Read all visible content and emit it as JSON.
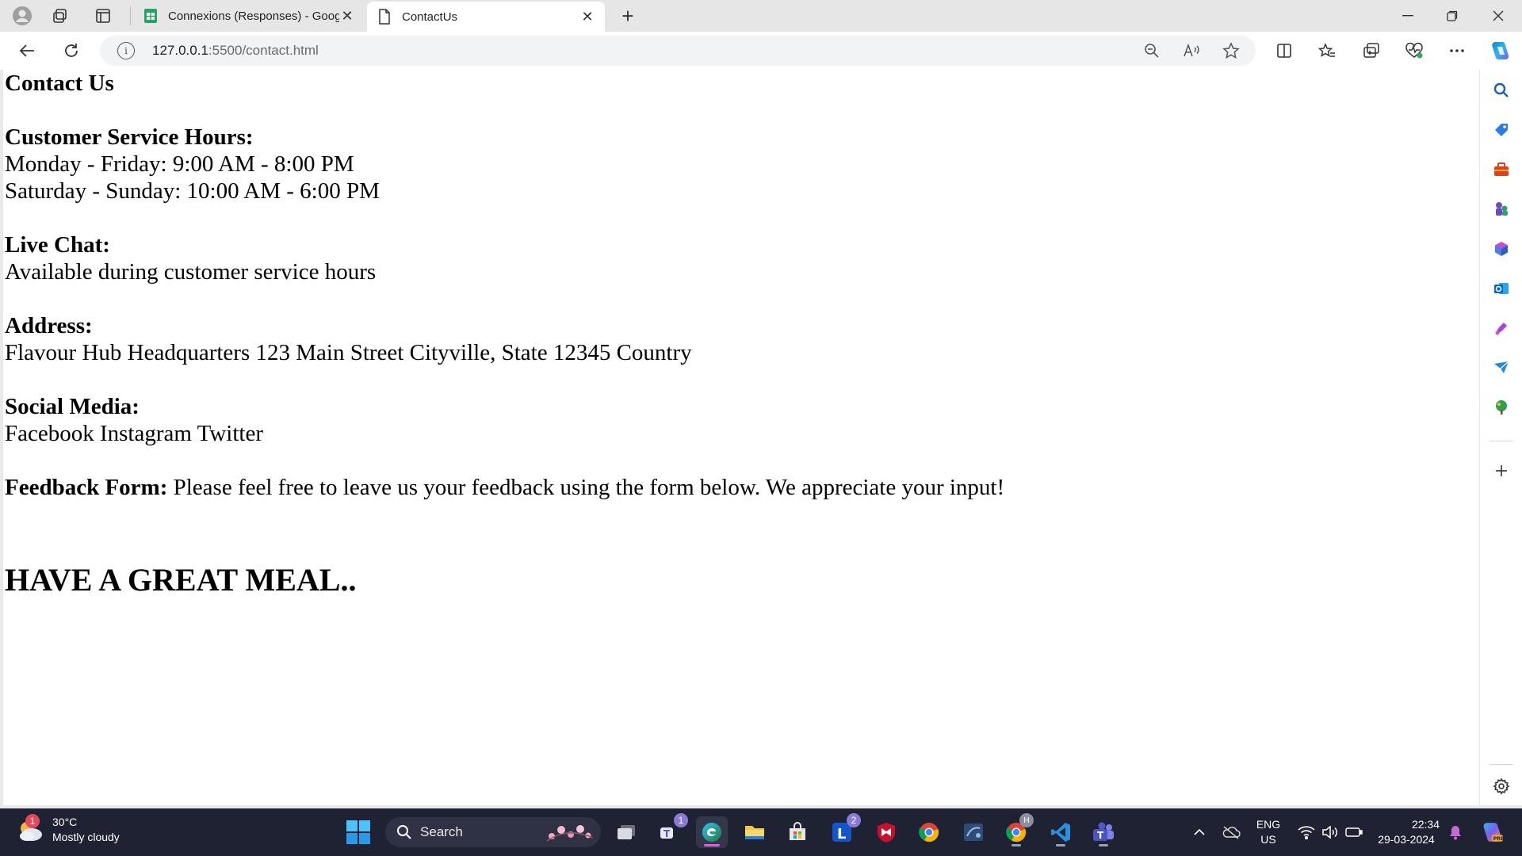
{
  "browser": {
    "tabs": [
      {
        "title": "Connexions (Responses) - Google",
        "active": false
      },
      {
        "title": "ContactUs",
        "active": true
      }
    ],
    "new_tab_label": "+",
    "address": {
      "host": "127.0.0.1",
      "path": ":5500/contact.html"
    }
  },
  "page": {
    "heading": "Contact Us",
    "hours": {
      "label": "Customer Service Hours:",
      "lines": [
        "Monday - Friday: 9:00 AM - 8:00 PM",
        "Saturday - Sunday: 10:00 AM - 6:00 PM"
      ]
    },
    "live_chat": {
      "label": "Live Chat:",
      "text": "Available during customer service hours"
    },
    "address": {
      "label": "Address:",
      "text": "Flavour Hub Headquarters 123 Main Street Cityville, State 12345 Country"
    },
    "social": {
      "label": "Social Media:",
      "text": "Facebook Instagram Twitter"
    },
    "feedback": {
      "label": "Feedback Form:",
      "text": " Please feel free to leave us your feedback using the form below. We appreciate your input!"
    },
    "closing": "HAVE A GREAT MEAL.."
  },
  "taskbar": {
    "weather": {
      "temp": "30°C",
      "condition": "Mostly cloudy",
      "badge": "1"
    },
    "search_label": "Search",
    "teams_badge": "1",
    "l_badge": "2",
    "chrome_badge": "H",
    "language": {
      "line1": "ENG",
      "line2": "US"
    },
    "clock": {
      "time": "22:34",
      "date": "29-03-2024"
    }
  },
  "colors": {
    "taskbar_bg": "#1f2233",
    "accent_edge": "#1a7fd4",
    "sheets_green": "#23a566"
  }
}
